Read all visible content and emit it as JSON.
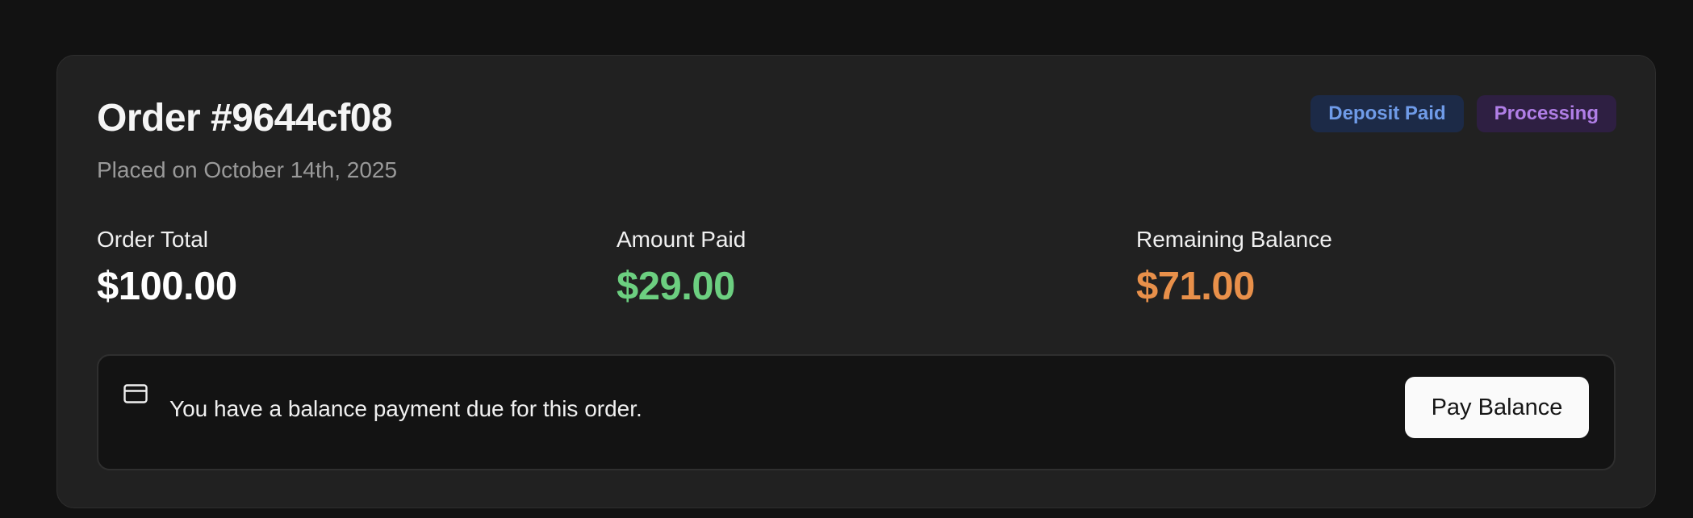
{
  "order": {
    "title": "Order #9644cf08",
    "placed_on": "Placed on October 14th, 2025",
    "badges": [
      {
        "label": "Deposit Paid",
        "color": "#6f9be8"
      },
      {
        "label": "Processing",
        "color": "#b07ee6"
      }
    ],
    "stats": [
      {
        "label": "Order Total",
        "value": "$100.00",
        "color": "#ffffff"
      },
      {
        "label": "Amount Paid",
        "value": "$29.00",
        "color": "#6ccf80"
      },
      {
        "label": "Remaining Balance",
        "value": "$71.00",
        "color": "#e8904a"
      }
    ]
  },
  "notice": {
    "icon": "credit-card-icon",
    "message": "You have a balance payment due for this order.",
    "button_label": "Pay Balance"
  }
}
